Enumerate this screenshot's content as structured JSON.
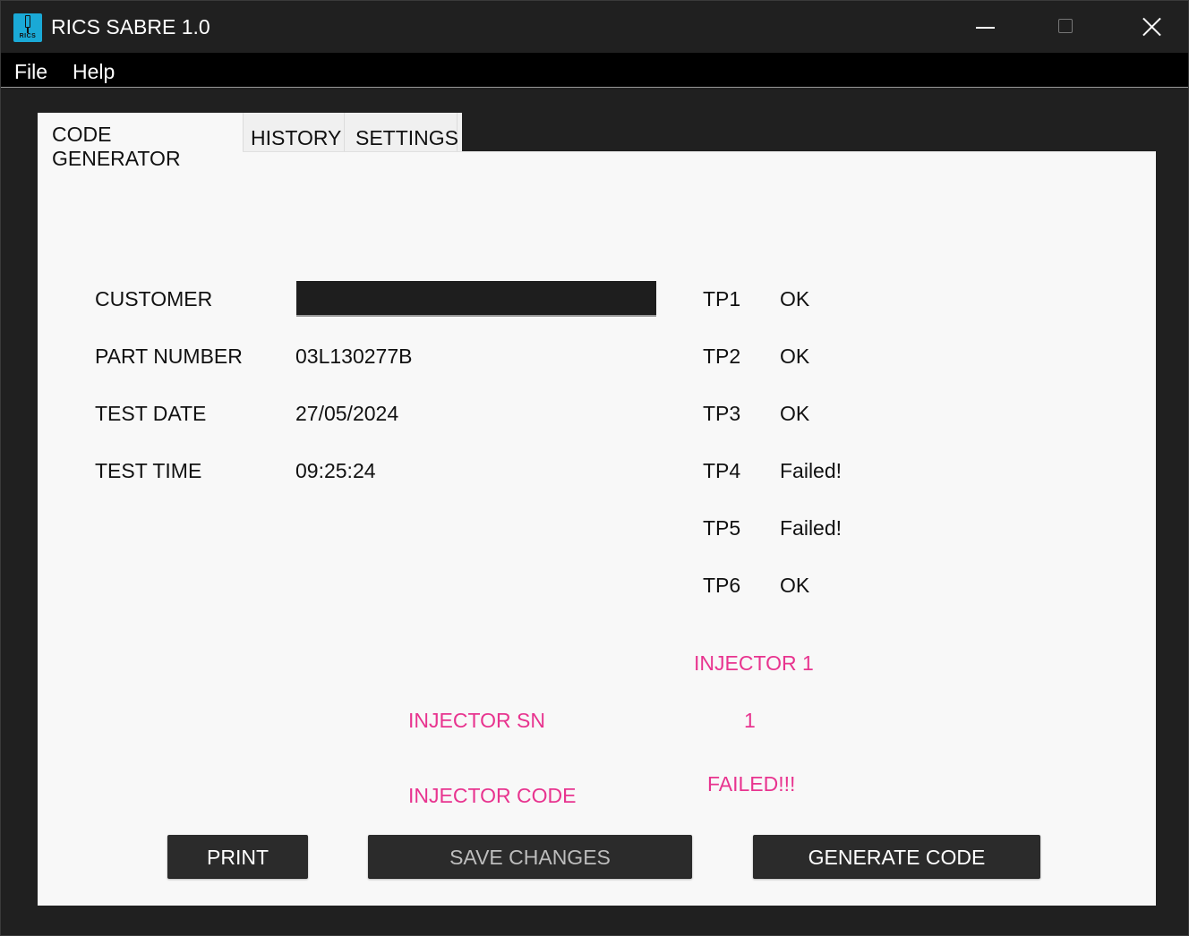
{
  "window": {
    "title": "RICS SABRE 1.0",
    "icon_text": "RICS",
    "accent": "#1aa9d6"
  },
  "menu": {
    "items": [
      {
        "label": "File"
      },
      {
        "label": "Help"
      }
    ]
  },
  "tabs": [
    {
      "label": "CODE GENERATOR",
      "active": true
    },
    {
      "label": "HISTORY",
      "active": false
    },
    {
      "label": "SETTINGS",
      "active": false
    }
  ],
  "form": {
    "customer_label": "CUSTOMER",
    "customer_value": "",
    "part_number_label": "PART NUMBER",
    "part_number_value": "03L130277B",
    "test_date_label": "TEST DATE",
    "test_date_value": "27/05/2024",
    "test_time_label": "TEST TIME",
    "test_time_value": "09:25:24"
  },
  "test_points": [
    {
      "name": "TP1",
      "status": "OK"
    },
    {
      "name": "TP2",
      "status": "OK"
    },
    {
      "name": "TP3",
      "status": "OK"
    },
    {
      "name": "TP4",
      "status": "Failed!"
    },
    {
      "name": "TP5",
      "status": "Failed!"
    },
    {
      "name": "TP6",
      "status": "OK"
    }
  ],
  "injector": {
    "heading": "INJECTOR 1",
    "sn_label": "INJECTOR SN",
    "sn_value": "1",
    "code_label": "INJECTOR CODE",
    "code_value": "FAILED!!!",
    "highlight_color": "#e8348f"
  },
  "buttons": {
    "print": "PRINT",
    "save_changes": "SAVE CHANGES",
    "generate_code": "GENERATE CODE"
  }
}
